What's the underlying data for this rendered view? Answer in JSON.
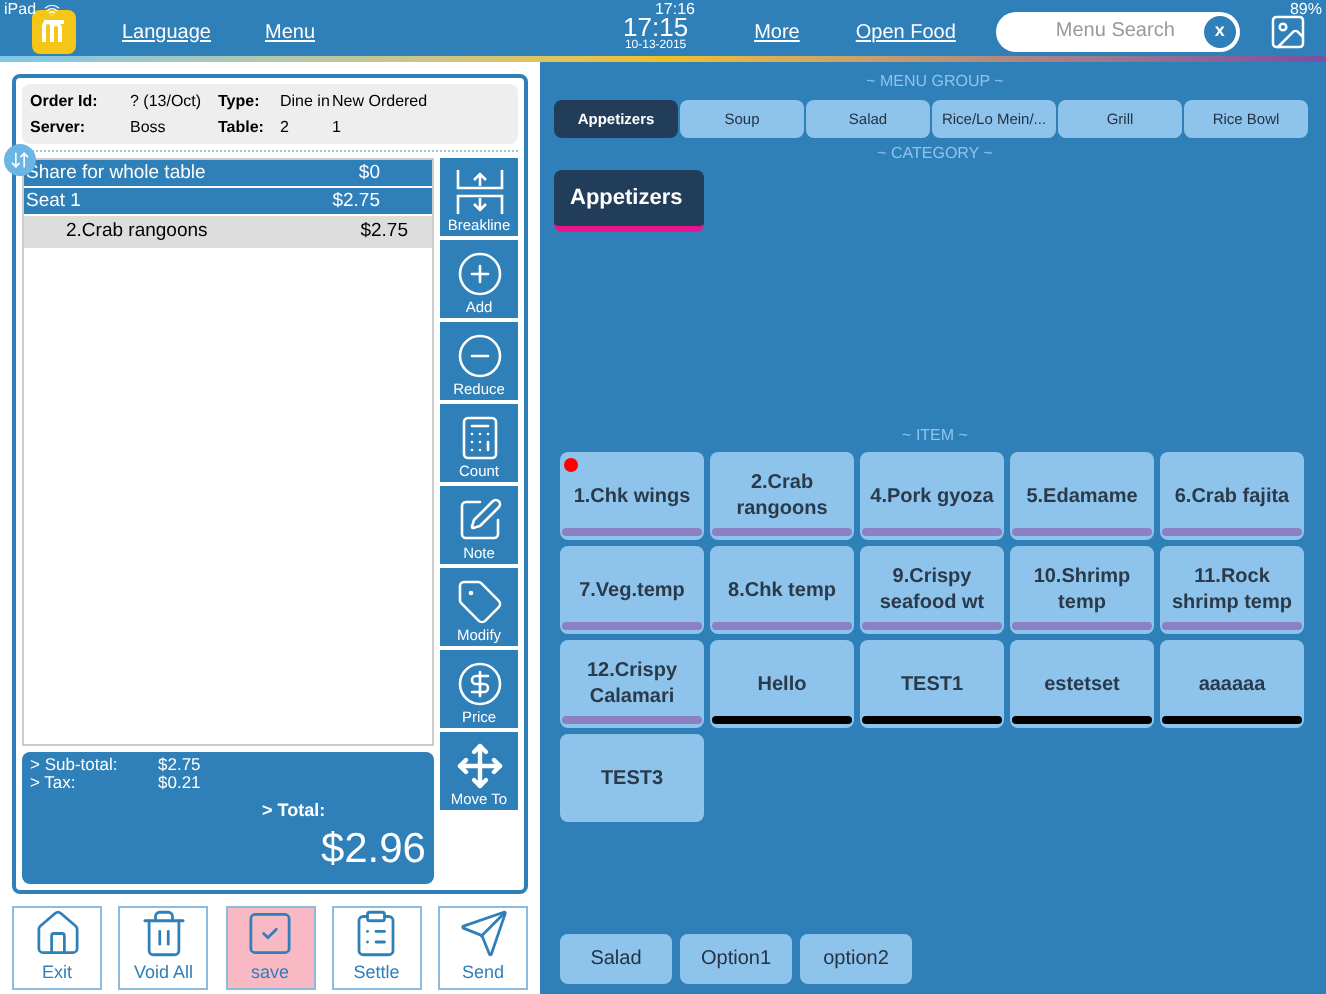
{
  "status_bar": {
    "device": "iPad",
    "time": "17:16",
    "battery": "89%"
  },
  "header": {
    "nav": [
      "Language",
      "Menu"
    ],
    "clock": {
      "time": "17:15",
      "date": "10-13-2015"
    },
    "nav_right": [
      "More",
      "Open Food"
    ],
    "search": {
      "placeholder": "Menu Search",
      "clear": "x"
    }
  },
  "order": {
    "info": [
      {
        "label": "Order Id:",
        "value": "? (13/Oct)",
        "label2": "Type:",
        "value2": "Dine in",
        "value3": "New Ordered"
      },
      {
        "label": "Server:",
        "value": "Boss",
        "label2": "Table:",
        "value2": "2",
        "value3": "1"
      }
    ],
    "lines": [
      {
        "kind": "header",
        "name": "Share for whole table",
        "price": "$0"
      },
      {
        "kind": "header",
        "name": "Seat 1",
        "price": "$2.75"
      },
      {
        "kind": "item",
        "name": "2.Crab rangoons",
        "price": "$2.75"
      }
    ],
    "totals": [
      {
        "label": "> Sub-total:",
        "value": "$2.75"
      },
      {
        "label": "> Tax:",
        "value": "$0.21"
      }
    ],
    "total_label": "> Total:",
    "total": "$2.96"
  },
  "side_actions": [
    {
      "kind": "breakline",
      "label": "Breakline"
    },
    {
      "kind": "add",
      "label": "Add"
    },
    {
      "kind": "reduce",
      "label": "Reduce"
    },
    {
      "kind": "count",
      "label": "Count"
    },
    {
      "kind": "note",
      "label": "Note"
    },
    {
      "kind": "modify",
      "label": "Modify"
    },
    {
      "kind": "price",
      "label": "Price"
    },
    {
      "kind": "move",
      "label": "Move To"
    }
  ],
  "bottom_actions": [
    {
      "kind": "exit",
      "label": "Exit",
      "selected": false
    },
    {
      "kind": "void",
      "label": "Void All",
      "selected": false
    },
    {
      "kind": "save",
      "label": "save",
      "selected": true
    },
    {
      "kind": "settle",
      "label": "Settle",
      "selected": false
    },
    {
      "kind": "send",
      "label": "Send",
      "selected": false
    }
  ],
  "menu_group": {
    "title": "~ MENU GROUP ~",
    "items": [
      {
        "label": "Appetizers",
        "selected": true
      },
      {
        "label": "Soup",
        "selected": false
      },
      {
        "label": "Salad",
        "selected": false
      },
      {
        "label": "Rice/Lo Mein/...",
        "selected": false
      },
      {
        "label": "Grill",
        "selected": false
      },
      {
        "label": "Rice Bowl",
        "selected": false
      }
    ]
  },
  "category": {
    "title": "~ CATEGORY ~",
    "items": [
      {
        "label": "Appetizers",
        "selected": true
      }
    ]
  },
  "items": {
    "title": "~ ITEM ~",
    "list": [
      {
        "label": "1.Chk wings",
        "flagged": true,
        "color": "#8b80c4"
      },
      {
        "label": "2.Crab rangoons",
        "flagged": false,
        "color": "#8b80c4"
      },
      {
        "label": "4.Pork gyoza",
        "flagged": false,
        "color": "#8b80c4"
      },
      {
        "label": "5.Edamame",
        "flagged": false,
        "color": "#8b80c4"
      },
      {
        "label": "6.Crab fajita",
        "flagged": false,
        "color": "#8b80c4"
      },
      {
        "label": "7.Veg.temp",
        "flagged": false,
        "color": "#8b80c4"
      },
      {
        "label": "8.Chk temp",
        "flagged": false,
        "color": "#8b80c4"
      },
      {
        "label": "9.Crispy seafood wt",
        "flagged": false,
        "color": "#8b80c4"
      },
      {
        "label": "10.Shrimp temp",
        "flagged": false,
        "color": "#8b80c4"
      },
      {
        "label": "11.Rock shrimp temp",
        "flagged": false,
        "color": "#8b80c4"
      },
      {
        "label": "12.Crispy Calamari",
        "flagged": false,
        "color": "#8b80c4"
      },
      {
        "label": "Hello",
        "flagged": false,
        "color": "#000000"
      },
      {
        "label": "TEST1",
        "flagged": false,
        "color": "#000000"
      },
      {
        "label": "estetset",
        "flagged": false,
        "color": "#000000"
      },
      {
        "label": "aaaaaa",
        "flagged": false,
        "color": "#000000"
      },
      {
        "label": "TEST3",
        "flagged": false
      }
    ]
  },
  "options": [
    "Salad",
    "Option1",
    "option2"
  ]
}
